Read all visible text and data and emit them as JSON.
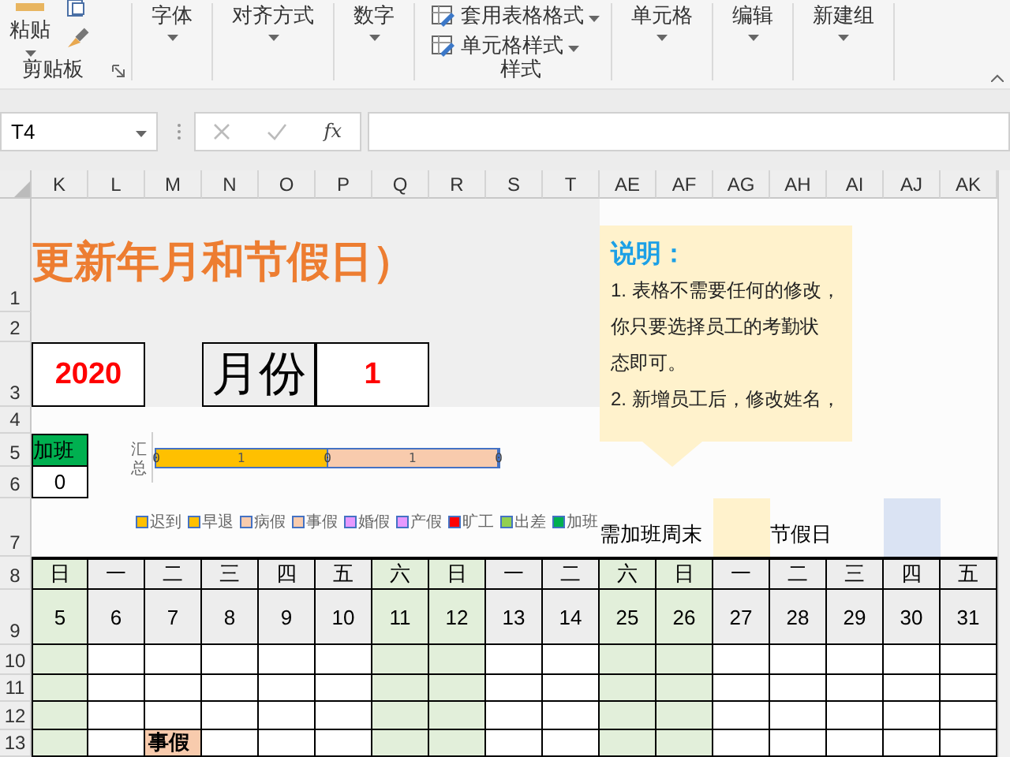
{
  "ribbon": [
    {
      "kind": "clipboard",
      "label": "剪贴板",
      "button": "粘贴"
    },
    {
      "kind": "menu",
      "label": "字体"
    },
    {
      "kind": "menu",
      "label": "对齐方式"
    },
    {
      "kind": "menu",
      "label": "数字"
    },
    {
      "kind": "styles",
      "label": "样式",
      "items": [
        "套用表格格式",
        "单元格样式"
      ]
    },
    {
      "kind": "menu",
      "label": "单元格"
    },
    {
      "kind": "menu",
      "label": "编辑"
    },
    {
      "kind": "menu",
      "label": "新建组"
    }
  ],
  "formula_bar": {
    "name_box": "T4",
    "function_symbol": "fx"
  },
  "columns": [
    "K",
    "L",
    "M",
    "N",
    "O",
    "P",
    "Q",
    "R",
    "S",
    "T",
    "AE",
    "AF",
    "AG",
    "AH",
    "AI",
    "AJ",
    "AK"
  ],
  "row_headers": [
    "1",
    "2",
    "3",
    "4",
    "5",
    "6",
    "7",
    "8",
    "9",
    "10",
    "11",
    "12",
    "13"
  ],
  "sheet": {
    "title": "更新年月和节假日）",
    "year": "2020",
    "month_label": "月份",
    "month": "1",
    "overtime": {
      "label": "加班",
      "value": "0"
    },
    "legend_keys": [
      {
        "label": "需加班周末",
        "color": "#fff2cc"
      },
      {
        "label": "节假日",
        "color": "#dae3f3"
      }
    ],
    "summary_chart": {
      "category": "汇总",
      "segments": [
        {
          "label": "1",
          "color": "#ffc000"
        },
        {
          "label": "1",
          "color": "#f8cbad"
        }
      ],
      "boundary_labels": [
        "0",
        "0",
        "0"
      ],
      "legend": [
        {
          "name": "迟到",
          "color": "#ffc000"
        },
        {
          "name": "早退",
          "color": "#ffc000"
        },
        {
          "name": "病假",
          "color": "#f8cbad"
        },
        {
          "name": "事假",
          "color": "#f8cbad"
        },
        {
          "name": "婚假",
          "color": "#e699ff"
        },
        {
          "name": "产假",
          "color": "#e699ff"
        },
        {
          "name": "旷工",
          "color": "#ff0000"
        },
        {
          "name": "出差",
          "color": "#92d050"
        },
        {
          "name": "加班",
          "color": "#00b050"
        }
      ]
    },
    "note": {
      "heading": "说明：",
      "lines": [
        "1. 表格不需要任何的修改，",
        "你只要选择员工的考勤状",
        "态即可。",
        "2. 新增员工后，修改姓名，"
      ]
    },
    "days": [
      {
        "weekday": "日",
        "date": "5",
        "weekend": true
      },
      {
        "weekday": "一",
        "date": "6",
        "weekend": false
      },
      {
        "weekday": "二",
        "date": "7",
        "weekend": false
      },
      {
        "weekday": "三",
        "date": "8",
        "weekend": false
      },
      {
        "weekday": "四",
        "date": "9",
        "weekend": false
      },
      {
        "weekday": "五",
        "date": "10",
        "weekend": false
      },
      {
        "weekday": "六",
        "date": "11",
        "weekend": true
      },
      {
        "weekday": "日",
        "date": "12",
        "weekend": true
      },
      {
        "weekday": "一",
        "date": "13",
        "weekend": false
      },
      {
        "weekday": "二",
        "date": "14",
        "weekend": false
      },
      {
        "weekday": "六",
        "date": "25",
        "weekend": true
      },
      {
        "weekday": "日",
        "date": "26",
        "weekend": true
      },
      {
        "weekday": "一",
        "date": "27",
        "weekend": false
      },
      {
        "weekday": "二",
        "date": "28",
        "weekend": false
      },
      {
        "weekday": "三",
        "date": "29",
        "weekend": false
      },
      {
        "weekday": "四",
        "date": "30",
        "weekend": false
      },
      {
        "weekday": "五",
        "date": "31",
        "weekend": false
      }
    ],
    "body_rows": [
      {
        "cells": [
          {
            "kind": "blank"
          },
          {
            "kind": "blank"
          },
          {
            "kind": "blank"
          },
          {
            "kind": "blank"
          },
          {
            "kind": "blank"
          },
          {
            "kind": "blank"
          },
          {
            "kind": "blank"
          },
          {
            "kind": "blank"
          },
          {
            "kind": "blank"
          },
          {
            "kind": "blank"
          },
          {
            "kind": "blank"
          },
          {
            "kind": "blank"
          },
          {
            "kind": "blank"
          },
          {
            "kind": "blank"
          },
          {
            "kind": "blank"
          },
          {
            "kind": "blank"
          },
          {
            "kind": "blank"
          }
        ]
      },
      {
        "cells": [
          {
            "kind": "blank"
          },
          {
            "kind": "blank"
          },
          {
            "kind": "blank"
          },
          {
            "kind": "blank"
          },
          {
            "kind": "blank"
          },
          {
            "kind": "blank"
          },
          {
            "kind": "blank"
          },
          {
            "kind": "blank"
          },
          {
            "kind": "blank"
          },
          {
            "kind": "blank"
          },
          {
            "kind": "blank"
          },
          {
            "kind": "blank"
          },
          {
            "kind": "blank"
          },
          {
            "kind": "blank"
          },
          {
            "kind": "blank"
          },
          {
            "kind": "blank"
          },
          {
            "kind": "blank"
          }
        ]
      },
      {
        "cells": [
          {
            "kind": "blank"
          },
          {
            "kind": "blank"
          },
          {
            "kind": "blank"
          },
          {
            "kind": "blank"
          },
          {
            "kind": "blank"
          },
          {
            "kind": "blank"
          },
          {
            "kind": "blank"
          },
          {
            "kind": "blank"
          },
          {
            "kind": "blank"
          },
          {
            "kind": "blank"
          },
          {
            "kind": "blank"
          },
          {
            "kind": "blank"
          },
          {
            "kind": "blank"
          },
          {
            "kind": "blank"
          },
          {
            "kind": "blank"
          },
          {
            "kind": "blank"
          },
          {
            "kind": "blank"
          }
        ]
      },
      {
        "cells": [
          {
            "kind": "blank"
          },
          {
            "kind": "blank"
          },
          {
            "kind": "leave",
            "text": "事假",
            "color": "#f8cbad"
          },
          {
            "kind": "blank"
          },
          {
            "kind": "blank"
          },
          {
            "kind": "blank"
          },
          {
            "kind": "blank"
          },
          {
            "kind": "blank"
          },
          {
            "kind": "blank"
          },
          {
            "kind": "blank"
          },
          {
            "kind": "blank"
          },
          {
            "kind": "blank"
          },
          {
            "kind": "blank"
          },
          {
            "kind": "blank"
          },
          {
            "kind": "blank"
          },
          {
            "kind": "blank"
          },
          {
            "kind": "blank"
          }
        ]
      }
    ]
  }
}
